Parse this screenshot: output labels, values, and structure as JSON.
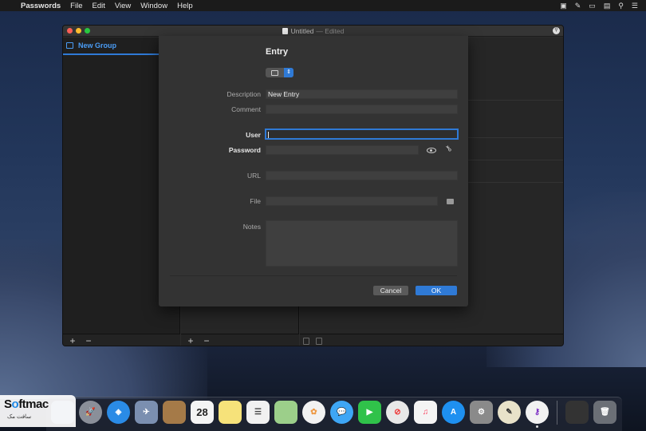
{
  "menubar": {
    "app_name": "Passwords",
    "items": [
      "File",
      "Edit",
      "View",
      "Window",
      "Help"
    ]
  },
  "window": {
    "title": "Untitled",
    "title_suffix": "— Edited",
    "sidebar_group": "New Group"
  },
  "sheet": {
    "title": "Entry",
    "labels": {
      "description": "Description",
      "comment": "Comment",
      "user": "User",
      "password": "Password",
      "url": "URL",
      "file": "File",
      "notes": "Notes"
    },
    "values": {
      "description": "New Entry",
      "comment": "",
      "user": "",
      "password": "",
      "url": "",
      "file": "",
      "notes": ""
    },
    "cancel_label": "Cancel",
    "ok_label": "OK"
  },
  "bottom": {
    "add_label": "+",
    "remove_label": "−"
  },
  "dock": {
    "calendar_day": "28"
  },
  "watermark": {
    "brand_a": "S",
    "brand_c": "o",
    "brand_b": "ftmac",
    "sub": "سافت مک"
  },
  "colors": {
    "accent": "#2f7ad6",
    "window_bg": "#2b2b2b",
    "sheet_bg": "#333333"
  }
}
